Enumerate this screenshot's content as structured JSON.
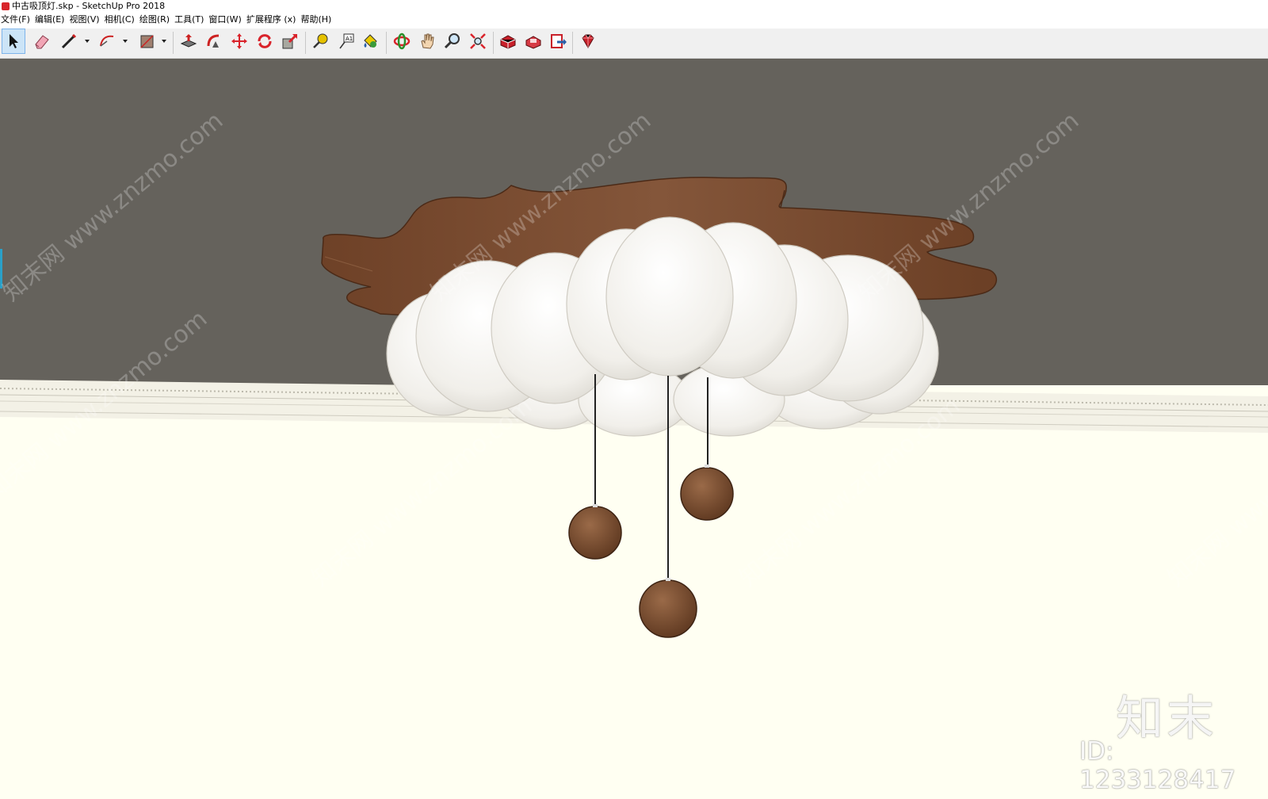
{
  "window": {
    "title": "中古吸顶灯.skp - SketchUp Pro 2018"
  },
  "menu": [
    "文件(F)",
    "编辑(E)",
    "视图(V)",
    "相机(C)",
    "绘图(R)",
    "工具(T)",
    "窗口(W)",
    "扩展程序 (x)",
    "帮助(H)"
  ],
  "toolbar": {
    "tools": [
      {
        "name": "select-tool-icon",
        "active": true
      },
      {
        "name": "eraser-tool-icon"
      },
      {
        "name": "line-tool-icon"
      },
      {
        "name": "arc-tool-icon"
      },
      {
        "name": "shape-tool-icon"
      },
      {
        "name": "push-pull-tool-icon"
      },
      {
        "name": "follow-me-tool-icon"
      },
      {
        "name": "move-tool-icon"
      },
      {
        "name": "rotate-tool-icon"
      },
      {
        "name": "scale-tool-icon"
      },
      {
        "name": "tape-measure-tool-icon"
      },
      {
        "name": "text-tool-icon"
      },
      {
        "name": "paint-bucket-tool-icon"
      },
      {
        "name": "orbit-tool-icon"
      },
      {
        "name": "pan-tool-icon"
      },
      {
        "name": "zoom-tool-icon"
      },
      {
        "name": "zoom-extents-tool-icon"
      },
      {
        "name": "3d-warehouse-icon"
      },
      {
        "name": "extension-warehouse-icon"
      },
      {
        "name": "send-to-layout-icon"
      },
      {
        "name": "ruby-console-icon"
      }
    ]
  },
  "watermark": {
    "brand": "知末",
    "id_label": "ID: 1233128417",
    "tile_text": "知末网 www.znzmo.com"
  },
  "colors": {
    "ceiling": "#65625c",
    "wall": "#fffff2",
    "wood": "#7a4a2c",
    "cloud": "#f4f2ee",
    "toolbar_bg": "#f0f0f0"
  }
}
